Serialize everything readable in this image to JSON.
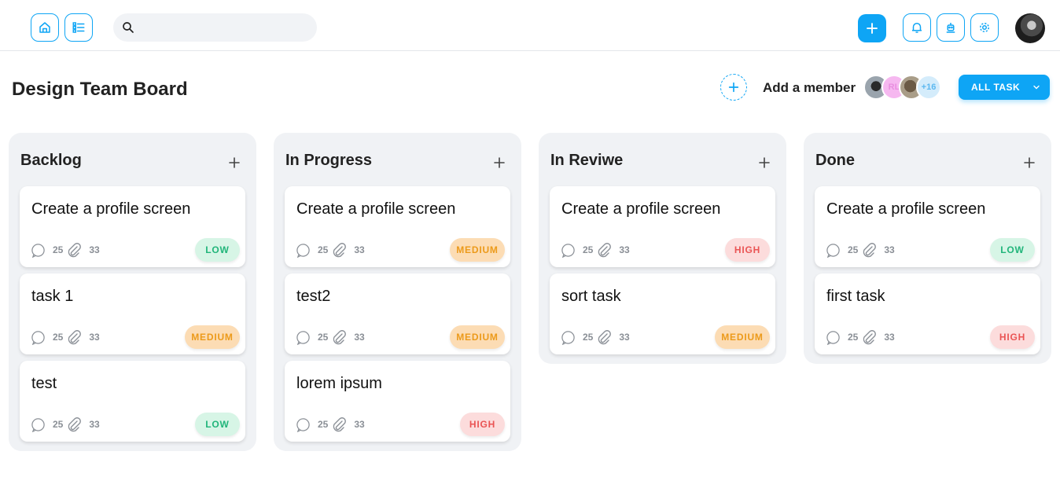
{
  "search": {
    "placeholder": ""
  },
  "board": {
    "title": "Design Team Board",
    "add_member_label": "Add a member",
    "members": [
      "",
      "RL",
      "",
      "+16"
    ],
    "filter_label": "ALL TASK"
  },
  "colors": {
    "accent": "#0ea5f5",
    "low": "#21b57a",
    "medium": "#ec9a1a",
    "high": "#ea5454",
    "column_bg": "#f0f2f5"
  },
  "columns": [
    {
      "title": "Backlog",
      "cards": [
        {
          "title": "Create a profile screen",
          "comments": "25",
          "attachments": "33",
          "priority": "LOW"
        },
        {
          "title": "task 1",
          "comments": "25",
          "attachments": "33",
          "priority": "MEDIUM"
        },
        {
          "title": "test",
          "comments": "25",
          "attachments": "33",
          "priority": "LOW"
        }
      ]
    },
    {
      "title": "In Progress",
      "cards": [
        {
          "title": "Create a profile screen",
          "comments": "25",
          "attachments": "33",
          "priority": "MEDIUM"
        },
        {
          "title": "test2",
          "comments": "25",
          "attachments": "33",
          "priority": "MEDIUM"
        },
        {
          "title": "lorem ipsum",
          "comments": "25",
          "attachments": "33",
          "priority": "HIGH"
        }
      ]
    },
    {
      "title": "In Reviwe",
      "cards": [
        {
          "title": "Create a profile screen",
          "comments": "25",
          "attachments": "33",
          "priority": "HIGH"
        },
        {
          "title": "sort task",
          "comments": "25",
          "attachments": "33",
          "priority": "MEDIUM"
        }
      ]
    },
    {
      "title": "Done",
      "cards": [
        {
          "title": "Create a profile screen",
          "comments": "25",
          "attachments": "33",
          "priority": "LOW"
        },
        {
          "title": "first task",
          "comments": "25",
          "attachments": "33",
          "priority": "HIGH"
        }
      ]
    }
  ]
}
